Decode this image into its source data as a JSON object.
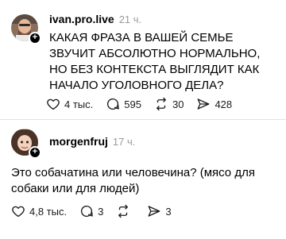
{
  "posts": [
    {
      "username": "ivan.pro.live",
      "time": "21 ч.",
      "text": "КАКАЯ ФРАЗА В ВАШЕЙ СЕМЬЕ ЗВУЧИТ АБСОЛЮТНО НОРМАЛЬНО, НО БЕЗ КОНТЕКСТА ВЫГЛЯДИТ КАК НАЧАЛО УГОЛОВНОГО ДЕЛА?",
      "likes": "4 тыс.",
      "comments": "595",
      "reposts": "30",
      "shares": "428"
    },
    {
      "username": "morgenfruj",
      "time": "17 ч.",
      "text": "Это собачатина или человечина? (мясо для собаки или для людей)",
      "likes": "4,8 тыс.",
      "comments": "3",
      "reposts": "",
      "shares": "3"
    }
  ],
  "icons": {
    "follow": "plus-icon",
    "like": "heart-icon",
    "comment": "comment-icon",
    "repost": "repost-icon",
    "share": "send-icon"
  },
  "colors": {
    "text": "#000000",
    "muted": "#9a9a9a",
    "divider": "#e2e2e2"
  }
}
